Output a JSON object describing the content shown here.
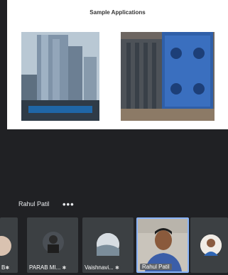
{
  "slide": {
    "title": "Sample Applications"
  },
  "speaker": {
    "name": "Rahul Patil",
    "more_icon": "more-horizontal-icon"
  },
  "participants": [
    {
      "label": "B",
      "mic": "✱"
    },
    {
      "label": "PARAB MI...",
      "mic": "✱"
    },
    {
      "label": "Vaishnavi...",
      "mic": "✱"
    },
    {
      "label": "Rahul Patil",
      "mic": ""
    },
    {
      "label": "",
      "mic": ""
    }
  ]
}
